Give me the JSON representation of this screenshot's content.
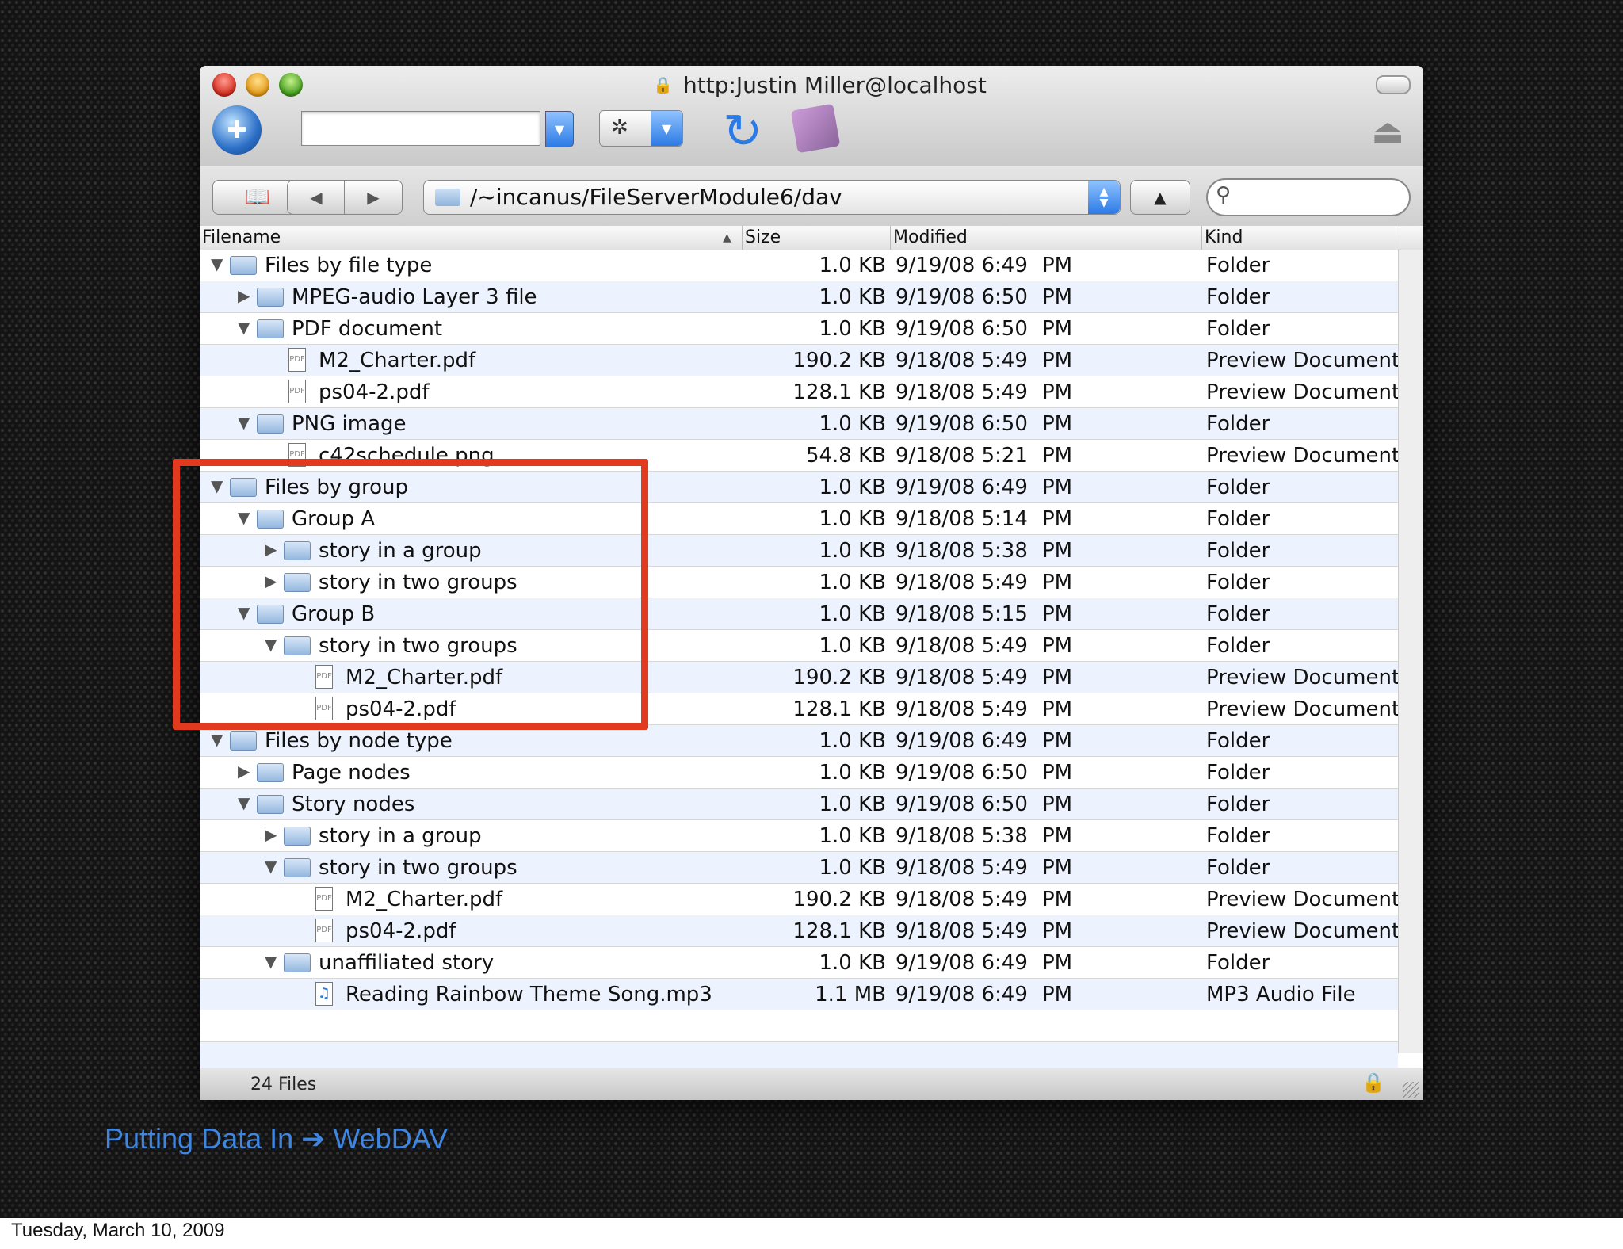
{
  "window": {
    "title": "http:Justin Miller@localhost",
    "path": "/~incanus/FileServerModule6/dav",
    "status": "24 Files"
  },
  "columns": {
    "filename": "Filename",
    "size": "Size",
    "modified": "Modified",
    "kind": "Kind"
  },
  "icons": {
    "lock": "🔒",
    "globe": "✚",
    "gear": "✲",
    "dropdown": "▼",
    "refresh": "↻",
    "eject": "⏏",
    "bookmarks": "📖",
    "back": "◀",
    "forward": "▶",
    "up": "▲",
    "search": "⚲",
    "sort": "▲",
    "file": "PDF",
    "mp3": "♫",
    "expanded": "▼",
    "collapsed": "▶"
  },
  "rows": [
    {
      "name": "Files by file type",
      "level": 0,
      "type": "folder",
      "expanded": true,
      "size": "1.0 KB",
      "date": "9/19/08 6:49",
      "ampm": "PM",
      "kind": "Folder"
    },
    {
      "name": "MPEG-audio Layer 3 file",
      "level": 1,
      "type": "folder",
      "expanded": false,
      "size": "1.0 KB",
      "date": "9/19/08 6:50",
      "ampm": "PM",
      "kind": "Folder"
    },
    {
      "name": "PDF document",
      "level": 1,
      "type": "folder",
      "expanded": true,
      "size": "1.0 KB",
      "date": "9/19/08 6:50",
      "ampm": "PM",
      "kind": "Folder"
    },
    {
      "name": "M2_Charter.pdf",
      "level": 2,
      "type": "file",
      "size": "190.2 KB",
      "date": "9/18/08 5:49",
      "ampm": "PM",
      "kind": "Preview Document"
    },
    {
      "name": "ps04-2.pdf",
      "level": 2,
      "type": "file",
      "size": "128.1 KB",
      "date": "9/18/08 5:49",
      "ampm": "PM",
      "kind": "Preview Document"
    },
    {
      "name": "PNG image",
      "level": 1,
      "type": "folder",
      "expanded": true,
      "size": "1.0 KB",
      "date": "9/19/08 6:50",
      "ampm": "PM",
      "kind": "Folder"
    },
    {
      "name": "c42schedule.png",
      "level": 2,
      "type": "file",
      "size": "54.8 KB",
      "date": "9/18/08 5:21",
      "ampm": "PM",
      "kind": "Preview Document"
    },
    {
      "name": "Files by group",
      "level": 0,
      "type": "folder",
      "expanded": true,
      "size": "1.0 KB",
      "date": "9/19/08 6:49",
      "ampm": "PM",
      "kind": "Folder"
    },
    {
      "name": "Group A",
      "level": 1,
      "type": "folder",
      "expanded": true,
      "size": "1.0 KB",
      "date": "9/18/08 5:14",
      "ampm": "PM",
      "kind": "Folder"
    },
    {
      "name": "story in a group",
      "level": 2,
      "type": "folder",
      "expanded": false,
      "size": "1.0 KB",
      "date": "9/18/08 5:38",
      "ampm": "PM",
      "kind": "Folder"
    },
    {
      "name": "story in two groups",
      "level": 2,
      "type": "folder",
      "expanded": false,
      "size": "1.0 KB",
      "date": "9/18/08 5:49",
      "ampm": "PM",
      "kind": "Folder"
    },
    {
      "name": "Group B",
      "level": 1,
      "type": "folder",
      "expanded": true,
      "size": "1.0 KB",
      "date": "9/18/08 5:15",
      "ampm": "PM",
      "kind": "Folder"
    },
    {
      "name": "story in two groups",
      "level": 2,
      "type": "folder",
      "expanded": true,
      "size": "1.0 KB",
      "date": "9/18/08 5:49",
      "ampm": "PM",
      "kind": "Folder"
    },
    {
      "name": "M2_Charter.pdf",
      "level": 3,
      "type": "file",
      "size": "190.2 KB",
      "date": "9/18/08 5:49",
      "ampm": "PM",
      "kind": "Preview Document"
    },
    {
      "name": "ps04-2.pdf",
      "level": 3,
      "type": "file",
      "size": "128.1 KB",
      "date": "9/18/08 5:49",
      "ampm": "PM",
      "kind": "Preview Document"
    },
    {
      "name": "Files by node type",
      "level": 0,
      "type": "folder",
      "expanded": true,
      "size": "1.0 KB",
      "date": "9/19/08 6:49",
      "ampm": "PM",
      "kind": "Folder"
    },
    {
      "name": "Page nodes",
      "level": 1,
      "type": "folder",
      "expanded": false,
      "size": "1.0 KB",
      "date": "9/19/08 6:50",
      "ampm": "PM",
      "kind": "Folder"
    },
    {
      "name": "Story nodes",
      "level": 1,
      "type": "folder",
      "expanded": true,
      "size": "1.0 KB",
      "date": "9/19/08 6:50",
      "ampm": "PM",
      "kind": "Folder"
    },
    {
      "name": "story in a group",
      "level": 2,
      "type": "folder",
      "expanded": false,
      "size": "1.0 KB",
      "date": "9/18/08 5:38",
      "ampm": "PM",
      "kind": "Folder"
    },
    {
      "name": "story in two groups",
      "level": 2,
      "type": "folder",
      "expanded": true,
      "size": "1.0 KB",
      "date": "9/18/08 5:49",
      "ampm": "PM",
      "kind": "Folder"
    },
    {
      "name": "M2_Charter.pdf",
      "level": 3,
      "type": "file",
      "size": "190.2 KB",
      "date": "9/18/08 5:49",
      "ampm": "PM",
      "kind": "Preview Document"
    },
    {
      "name": "ps04-2.pdf",
      "level": 3,
      "type": "file",
      "size": "128.1 KB",
      "date": "9/18/08 5:49",
      "ampm": "PM",
      "kind": "Preview Document"
    },
    {
      "name": "unaffiliated story",
      "level": 2,
      "type": "folder",
      "expanded": true,
      "size": "1.0 KB",
      "date": "9/19/08 6:49",
      "ampm": "PM",
      "kind": "Folder"
    },
    {
      "name": "Reading Rainbow Theme Song.mp3",
      "level": 3,
      "type": "mp3",
      "size": "1.1 MB",
      "date": "9/19/08 6:49",
      "ampm": "PM",
      "kind": "MP3 Audio File"
    }
  ],
  "slide": {
    "caption": "Putting Data In ➔ WebDAV",
    "footer_date": "Tuesday, March 10, 2009"
  }
}
